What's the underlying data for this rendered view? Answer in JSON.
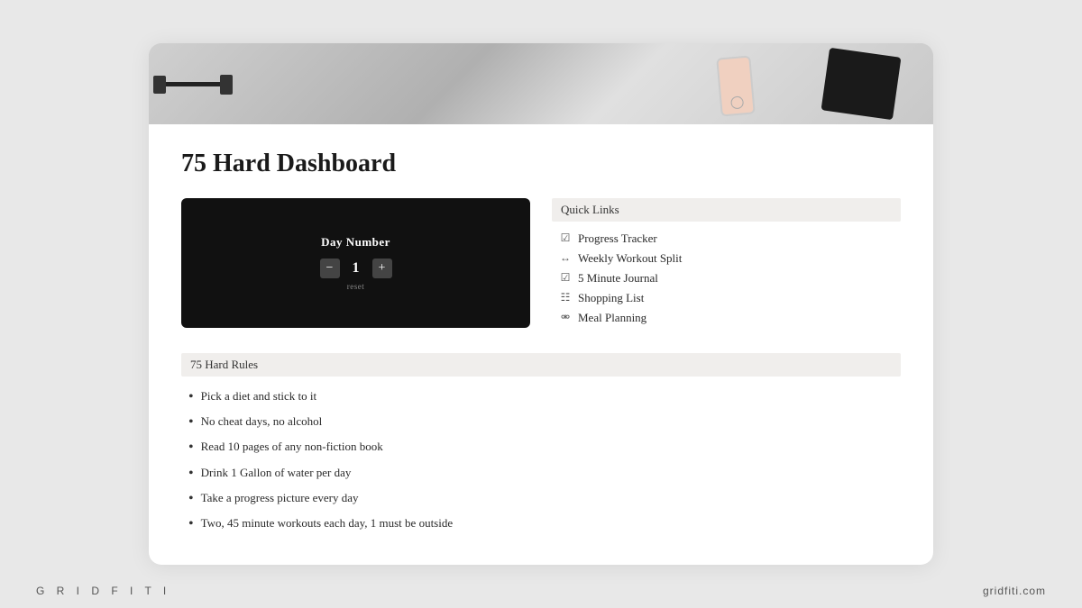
{
  "page": {
    "title": "75 Hard Dashboard",
    "brand_left": "G R I D F I T I",
    "brand_right": "gridfiti.com"
  },
  "day_counter": {
    "label": "Day Number",
    "value": "1",
    "minus": "−",
    "plus": "+",
    "reset": "reset"
  },
  "quick_links": {
    "header": "Quick Links",
    "items": [
      {
        "icon": "☑",
        "label": "Progress Tracker"
      },
      {
        "icon": "↔",
        "label": "Weekly Workout Split"
      },
      {
        "icon": "☑",
        "label": "5 Minute Journal"
      },
      {
        "icon": "☷",
        "label": "Shopping List"
      },
      {
        "icon": "⚮",
        "label": "Meal Planning"
      }
    ]
  },
  "rules": {
    "header": "75 Hard Rules",
    "items": [
      "Pick a diet and stick to it",
      "No cheat days, no alcohol",
      "Read 10 pages of any non-fiction book",
      "Drink 1 Gallon of water per day",
      "Take a progress picture every day",
      "Two, 45 minute workouts each day, 1 must be outside"
    ]
  }
}
